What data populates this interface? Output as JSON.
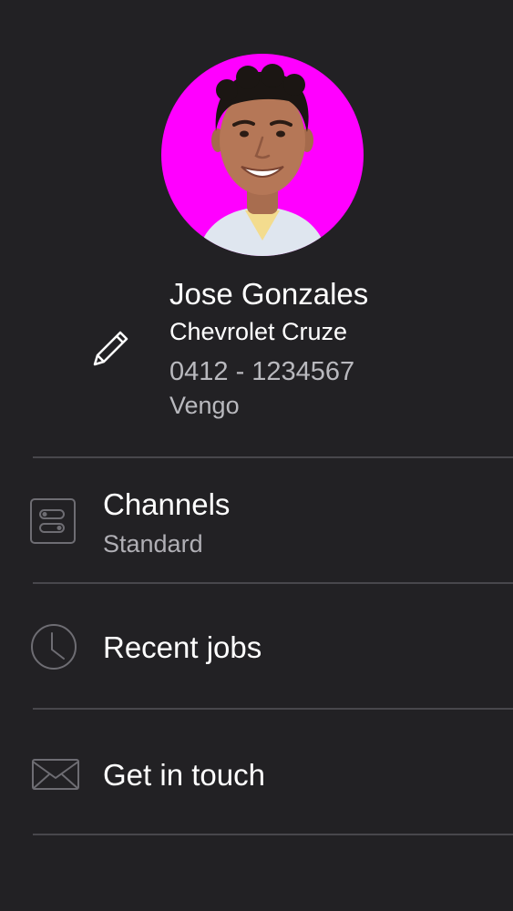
{
  "profile": {
    "name": "Jose Gonzales",
    "vehicle": "Chevrolet Cruze",
    "phone": "0412 - 1234567",
    "company": "Vengo",
    "avatar_bg": "#ff00ff",
    "edit_icon": "pencil-icon"
  },
  "menu": {
    "channels": {
      "label": "Channels",
      "sub": "Standard",
      "icon": "toggles-icon"
    },
    "recent_jobs": {
      "label": "Recent jobs",
      "icon": "clock-icon"
    },
    "get_in_touch": {
      "label": "Get in touch",
      "icon": "envelope-icon"
    }
  },
  "colors": {
    "background": "#222124",
    "divider": "#48474c",
    "icon_stroke": "#6e6d73",
    "secondary_text": "#b9b9be"
  }
}
